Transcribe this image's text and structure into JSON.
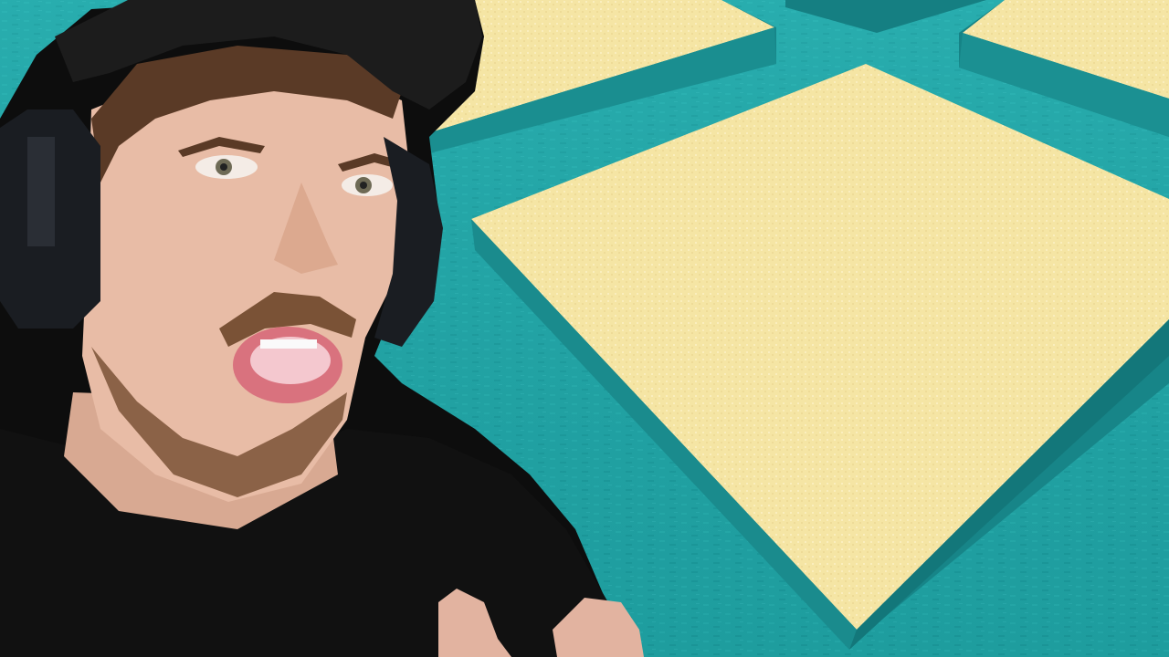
{
  "scene": {
    "description_type": "minecraft-water-world-with-sand-islands",
    "colors": {
      "water_light": "#2fb3b3",
      "water_mid": "#1e9a9c",
      "water_dark": "#137a7d",
      "water_shadow": "#0f6a6c",
      "sand_top": "#f6e7a8",
      "sand_highlight": "#fbf0c0",
      "sand_side": "#1f8a8a",
      "shirt": "#111111",
      "cap": "#1c1c1c",
      "headphones": "#1a1d22",
      "skin": "#e8bca6",
      "hair": "#5a3a26",
      "beard": "#7a5236",
      "lips": "#d9727e",
      "outline": "#0d0d0d"
    },
    "islands": [
      {
        "id": "island-center-large"
      },
      {
        "id": "island-top-middle"
      },
      {
        "id": "island-top-right"
      },
      {
        "id": "island-far-top"
      }
    ],
    "streamer": {
      "accessories": [
        "cap",
        "headphones",
        "t-shirt"
      ]
    }
  }
}
